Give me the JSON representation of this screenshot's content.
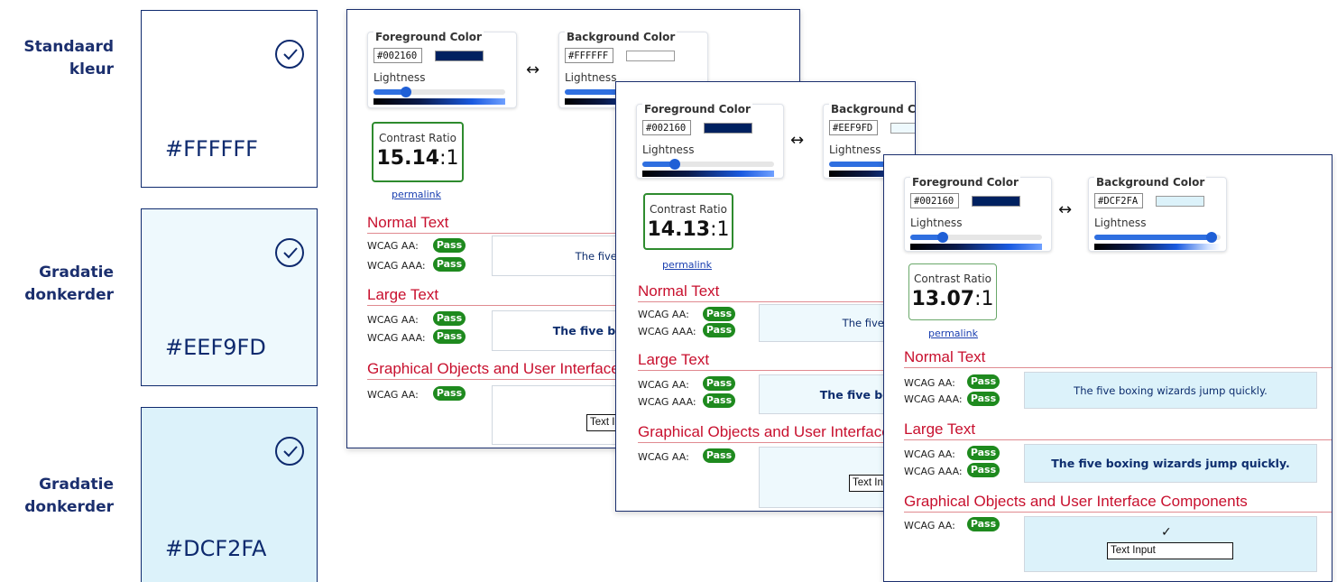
{
  "swatches": [
    {
      "label_line1": "Standaard",
      "label_line2": "kleur",
      "hex": "#FFFFFF",
      "color": "#FFFFFF",
      "check_icon": "check-circle-icon"
    },
    {
      "label_line1": "Gradatie",
      "label_line2": "donkerder",
      "hex": "#EEF9FD",
      "color": "#EEF9FD",
      "check_icon": "check-circle-icon"
    },
    {
      "label_line1": "Gradatie",
      "label_line2": "donkerder",
      "hex": "#DCF2FA",
      "color": "#DCF2FA",
      "check_icon": "check-circle-icon"
    }
  ],
  "panels": [
    {
      "fg_title": "Foreground Color",
      "fg_hex": "#002160",
      "fg_color": "#002160",
      "bg_title": "Background Color",
      "bg_hex": "#FFFFFF",
      "bg_color": "#FFFFFF",
      "lightness_label": "Lightness",
      "swap_icon": "↔",
      "fg_lightness": 0.25,
      "bg_lightness": 1.0,
      "ratio_label": "Contrast Ratio",
      "ratio_bold": "15.14",
      "ratio_rest": ":1",
      "permalink": "permalink",
      "normal_text": "Normal Text",
      "large_text": "Large Text",
      "graphical": "Graphical Objects and User Interface Components",
      "wcag_aa": "WCAG AA:",
      "wcag_aaa": "WCAG AAA:",
      "pass": "Pass",
      "sample": "The five boxing wizards jump quickly.",
      "text_input": "Text Input",
      "checkmark": "✓"
    },
    {
      "fg_title": "Foreground Color",
      "fg_hex": "#002160",
      "fg_color": "#002160",
      "bg_title": "Background Color",
      "bg_hex": "#EEF9FD",
      "bg_color": "#EEF9FD",
      "lightness_label": "Lightness",
      "swap_icon": "↔",
      "fg_lightness": 0.25,
      "bg_lightness": 0.97,
      "ratio_label": "Contrast Ratio",
      "ratio_bold": "14.13",
      "ratio_rest": ":1",
      "permalink": "permalink",
      "normal_text": "Normal Text",
      "large_text": "Large Text",
      "graphical": "Graphical Objects and User Interface Components",
      "wcag_aa": "WCAG AA:",
      "wcag_aaa": "WCAG AAA:",
      "pass": "Pass",
      "sample": "The five boxing wizards jump quickly.",
      "text_input": "Text Input",
      "checkmark": "✓"
    },
    {
      "fg_title": "Foreground Color",
      "fg_hex": "#002160",
      "fg_color": "#002160",
      "bg_title": "Background Color",
      "bg_hex": "#DCF2FA",
      "bg_color": "#DCF2FA",
      "lightness_label": "Lightness",
      "swap_icon": "↔",
      "fg_lightness": 0.25,
      "bg_lightness": 0.93,
      "ratio_label": "Contrast Ratio",
      "ratio_bold": "13.07",
      "ratio_rest": ":1",
      "permalink": "permalink",
      "normal_text": "Normal Text",
      "large_text": "Large Text",
      "graphical": "Graphical Objects and User Interface Components",
      "wcag_aa": "WCAG AA:",
      "wcag_aaa": "WCAG AAA:",
      "pass": "Pass",
      "sample": "The five boxing wizards jump quickly.",
      "text_input": "Text Input",
      "checkmark": "✓"
    }
  ],
  "colors": {
    "brand_navy": "#0E2A6E",
    "pass_green": "#1E8A1E",
    "heading_red": "#C8102E",
    "ratio_border": "#2E8B2E"
  }
}
